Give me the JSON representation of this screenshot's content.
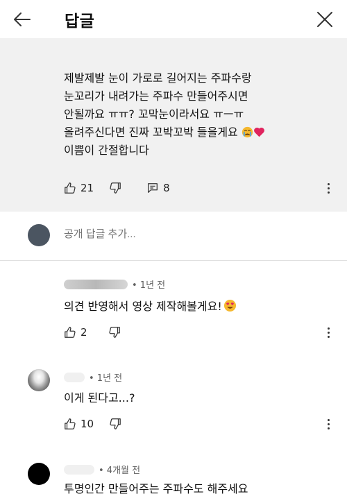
{
  "header": {
    "title": "답글"
  },
  "parent_comment": {
    "lines": [
      "제발제발 눈이 가로로 길어지는 주파수랑",
      "눈꼬리가 내려가는 주파수 만들어주시면",
      "안될까요 ㅠㅠ? 꼬막눈이라서요 ㅠㅡㅠ",
      "올려주신다면 진짜 꼬박꼬박 들을게요",
      "이쁨이 간절합니다"
    ],
    "likes": "21",
    "replies": "8"
  },
  "add_reply": {
    "placeholder": "공개 답글 추가..."
  },
  "replies": [
    {
      "time": "• 1년 전",
      "text": "의견 반영해서 영상 제작해볼게요!",
      "likes": "2"
    },
    {
      "time": "• 1년 전",
      "text": "이게 된다고...?",
      "likes": "10"
    },
    {
      "time": "• 4개월 전",
      "text": "투명인간 만들어주는 주파수도 해주세요"
    }
  ],
  "icons": {
    "back": "arrow-left-icon",
    "close": "close-icon",
    "like": "thumbs-up-icon",
    "dislike": "thumbs-down-icon",
    "replies": "comment-icon",
    "more": "more-vert-icon",
    "emoji": [
      "crying-face-emoji",
      "red-heart-emoji",
      "heart-eyes-emoji"
    ]
  },
  "colors": {
    "parent_bg": "#f1f1f1",
    "heart": "#e0245e",
    "emoji": "#f5b82e"
  }
}
